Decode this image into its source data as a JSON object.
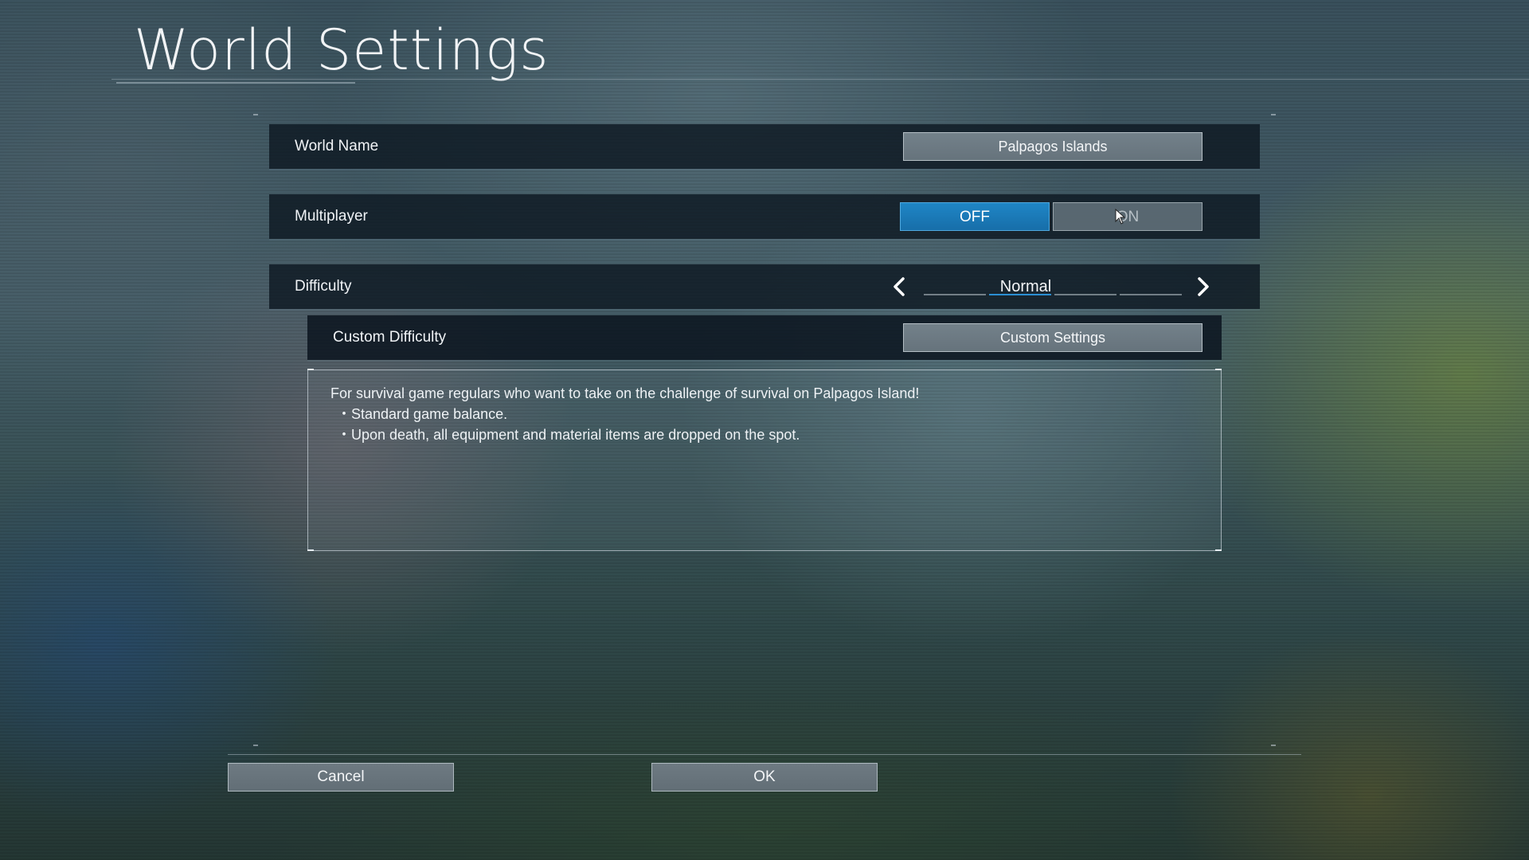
{
  "screen": {
    "title": "World Settings"
  },
  "settings": {
    "world_name": {
      "label": "World Name",
      "value": "Palpagos Islands"
    },
    "multiplayer": {
      "label": "Multiplayer",
      "off_label": "OFF",
      "on_label": "ON",
      "selected": "OFF"
    },
    "difficulty": {
      "label": "Difficulty",
      "value": "Normal",
      "left_icon": "chevron-left-icon",
      "right_icon": "chevron-right-icon",
      "levels_count": 4,
      "active_level": 2
    },
    "custom_difficulty": {
      "label": "Custom Difficulty",
      "button_label": "Custom Settings"
    }
  },
  "description": {
    "intro": "For survival game regulars who want to take on the challenge of survival on Palpagos Island!",
    "bullets": [
      "・Standard game balance.",
      "・Upon death, all equipment and material items are dropped on the spot."
    ]
  },
  "actions": {
    "cancel_label": "Cancel",
    "ok_label": "OK"
  },
  "colors": {
    "accent_blue": "#1f86c6",
    "row_bg": "#0e1822",
    "button_gray": "#6e7a82"
  }
}
